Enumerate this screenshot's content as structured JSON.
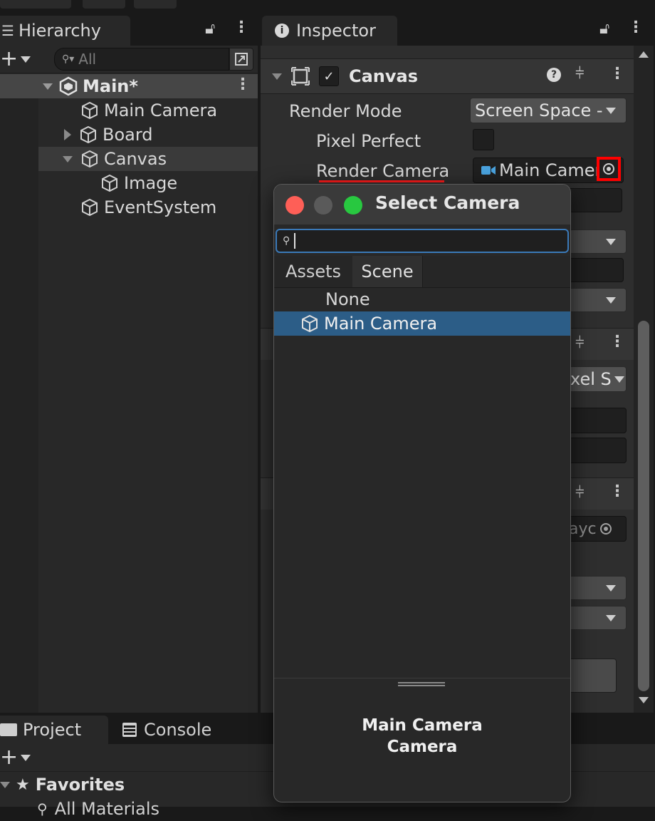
{
  "hierarchy": {
    "tab_label": "Hierarchy",
    "search_placeholder": "All",
    "scene_name": "Main*",
    "items": [
      {
        "label": "Main Camera"
      },
      {
        "label": "Board"
      },
      {
        "label": "Canvas"
      },
      {
        "label": "Image"
      },
      {
        "label": "EventSystem"
      }
    ]
  },
  "inspector": {
    "tab_label": "Inspector",
    "component_name": "Canvas",
    "render_mode_label": "Render Mode",
    "render_mode_value": "Screen Space -",
    "pixel_perfect_label": "Pixel Perfect",
    "render_camera_label": "Render Camera",
    "render_camera_value": "Main Camer",
    "partial_dropdown_1": "xel S",
    "partial_field_2": "ayc"
  },
  "dialog": {
    "title": "Select Camera",
    "tabs": [
      {
        "label": "Assets"
      },
      {
        "label": "Scene"
      }
    ],
    "items": [
      {
        "label": "None"
      },
      {
        "label": "Main Camera"
      }
    ],
    "selection_name": "Main Camera",
    "selection_type": "Camera"
  },
  "bottom": {
    "project_tab": "Project",
    "console_tab": "Console",
    "favorites_label": "Favorites",
    "all_materials": "All Materials"
  },
  "colors": {
    "selection": "#2c5d87",
    "highlight_red": "#ff0000",
    "traffic_red": "#fe5f57",
    "traffic_gray": "#5a5a5a",
    "traffic_green": "#28c840"
  }
}
